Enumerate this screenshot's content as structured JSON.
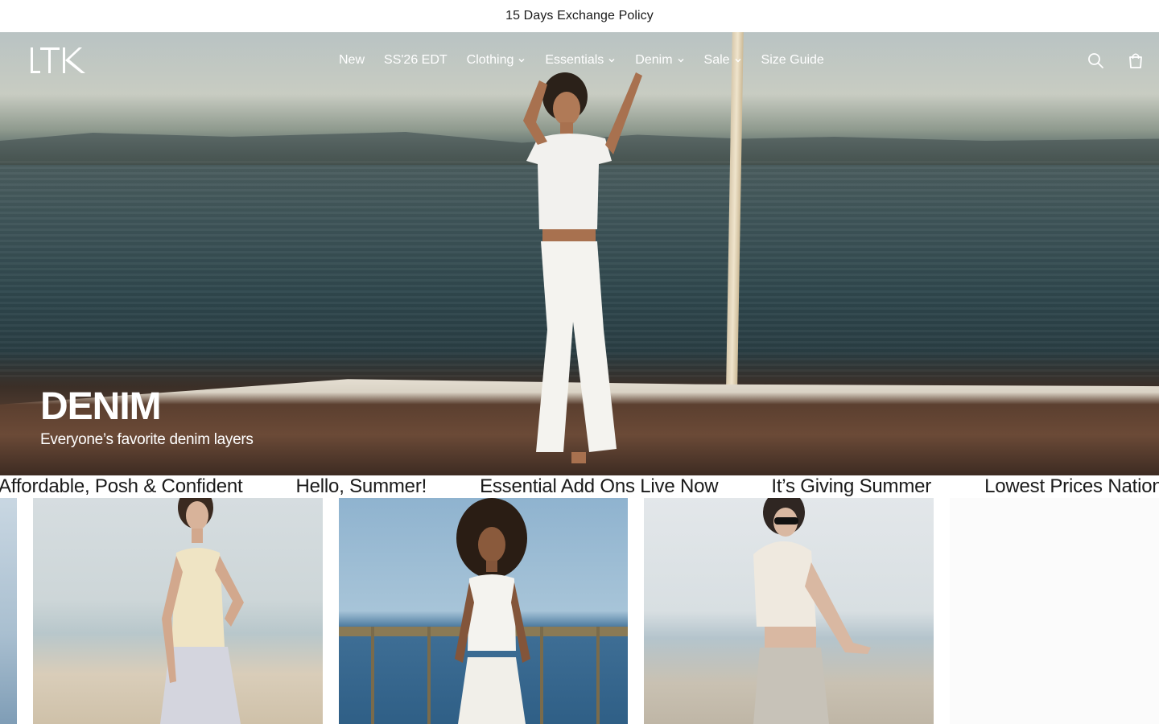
{
  "announcement": {
    "text": "15 Days Exchange Policy"
  },
  "header": {
    "logo_text": "LTK",
    "nav": [
      {
        "label": "New",
        "has_dropdown": false
      },
      {
        "label": "SS'26 EDT",
        "has_dropdown": false
      },
      {
        "label": "Clothing",
        "has_dropdown": true
      },
      {
        "label": "Essentials",
        "has_dropdown": true
      },
      {
        "label": "Denim",
        "has_dropdown": true
      },
      {
        "label": "Sale",
        "has_dropdown": true
      },
      {
        "label": "Size Guide",
        "has_dropdown": false
      }
    ],
    "icons": [
      "search-icon",
      "shopping-bag-icon"
    ]
  },
  "hero": {
    "title": "DENIM",
    "subtitle": "Everyone’s favorite denim layers"
  },
  "marquee": {
    "items": [
      "Affordable, Posh & Confident",
      "Hello, Summer!",
      "Essential Add Ons Live Now",
      "It’s Giving Summer",
      "Lowest Prices Nationwide"
    ]
  },
  "colors": {
    "background": "#ffffff",
    "text": "#1a1a1a",
    "nav_text": "#ffffff"
  }
}
